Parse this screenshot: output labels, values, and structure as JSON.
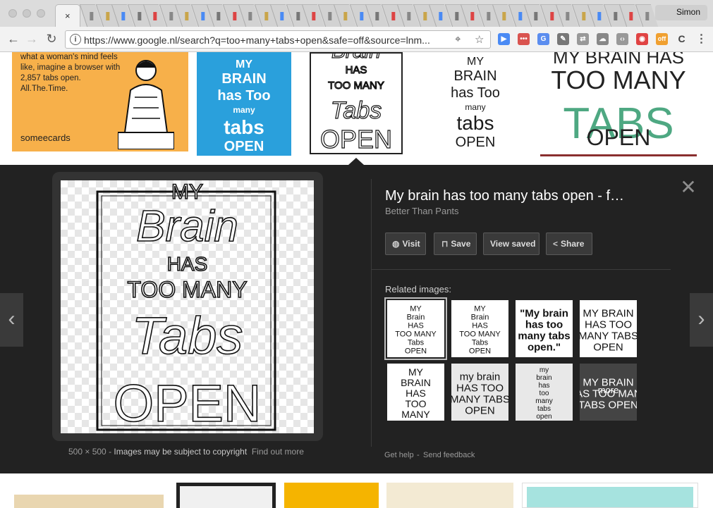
{
  "browser": {
    "active_tab_close": "×",
    "profile": "Simon",
    "url": "https://www.google.nl/search?q=too+many+tabs+open&safe=off&source=lnm...",
    "extension_badge": "off"
  },
  "thumbnails": {
    "t1": {
      "text": "what a woman's mind feels like, imagine a browser with 2,857 tabs open. All.The.Time.",
      "logo": "someecards"
    },
    "t2": {
      "lines": [
        "MY",
        "BRAIN",
        "has Too",
        "many",
        "tabs",
        "OPEN"
      ]
    },
    "t3": {
      "lines": [
        "Brain",
        "HAS",
        "TOO MANY",
        "Tabs",
        "OPEN"
      ]
    },
    "t4": {
      "lines": [
        "MY",
        "BRAIN",
        "has Too",
        "many",
        "tabs",
        "OPEN"
      ]
    },
    "t5": {
      "lines": [
        "MY BRAIN HAS",
        "TOO MANY",
        "TABS",
        "OPEN"
      ]
    }
  },
  "preview": {
    "poster_lines": [
      "MY",
      "Brain",
      "HAS",
      "TOO MANY",
      "Tabs",
      "OPEN"
    ],
    "dimensions": "500 × 500",
    "sep": "-",
    "copyright": "Images may be subject to copyright",
    "find_out_more": "Find out more",
    "title": "My brain has too many tabs open - f…",
    "source": "Better Than Pants",
    "actions": {
      "visit": "Visit",
      "save": "Save",
      "view_saved": "View saved",
      "share": "Share"
    },
    "related_label": "Related images:",
    "related": [
      {
        "lines": [
          "MY",
          "Brain",
          "HAS",
          "TOO MANY",
          "Tabs",
          "OPEN"
        ]
      },
      {
        "lines": [
          "MY",
          "Brain",
          "HAS",
          "TOO MANY",
          "Tabs",
          "OPEN"
        ]
      },
      {
        "lines": [
          "\"My brain",
          "has too",
          "many tabs",
          "open.\""
        ]
      },
      {
        "lines": [
          "MY BRAIN",
          "HAS TOO",
          "MANY TABS",
          "OPEN"
        ]
      },
      {
        "lines": [
          "MY",
          "BRAIN",
          "HAS",
          "TOO",
          "MANY"
        ]
      },
      {
        "lines": [
          "my brain",
          "HAS TOO",
          "MANY TABS",
          "OPEN"
        ]
      },
      {
        "lines": [
          "my",
          "brain",
          "has",
          "too",
          "many",
          "tabs",
          "open"
        ]
      },
      {
        "lines": [
          "MY BRAIN",
          "HAS TOO MANY",
          "TABS OPEN"
        ]
      }
    ],
    "more_label": "more",
    "get_help": "Get help",
    "send_feedback": "Send feedback",
    "prev": "‹",
    "next": "›"
  }
}
